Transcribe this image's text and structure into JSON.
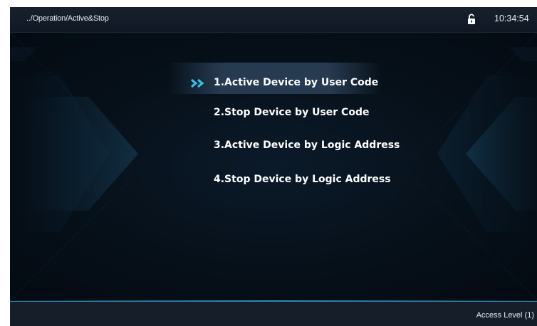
{
  "header": {
    "breadcrumb": "../Operation/Active&Stop",
    "lock_icon": "unlocked-padlock-icon",
    "time": "10:34:54"
  },
  "menu": {
    "selected_index": 0,
    "selection_icon": "double-chevron-right-icon",
    "items": [
      {
        "label": "1.Active Device by User Code"
      },
      {
        "label": "2.Stop Device by User Code"
      },
      {
        "label": "3.Active Device by Logic Address"
      },
      {
        "label": "4.Stop Device by Logic Address"
      }
    ]
  },
  "footer": {
    "access_level": "Access Level (1)"
  },
  "colors": {
    "background": "#050b14",
    "accent": "#2fc6f4",
    "text": "#ffffff"
  }
}
